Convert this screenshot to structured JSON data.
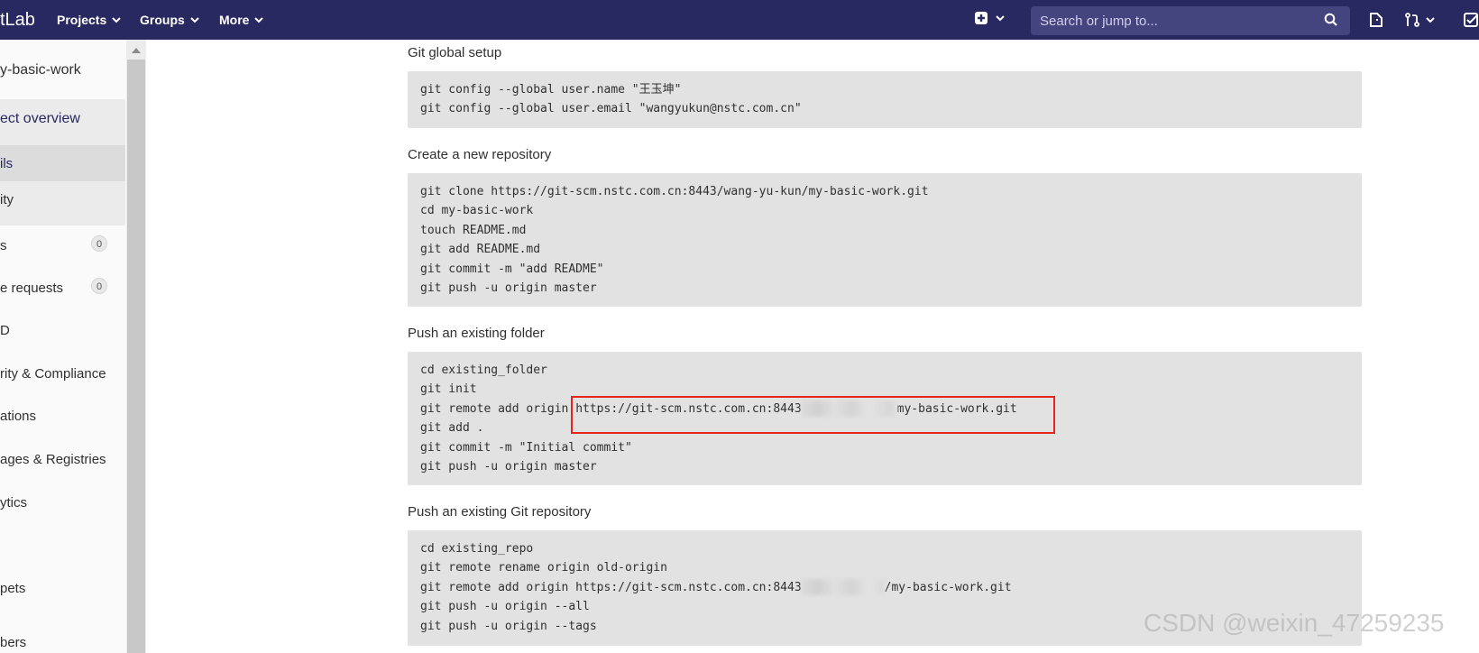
{
  "header": {
    "logo_text": "tLab",
    "nav": {
      "projects": "Projects",
      "groups": "Groups",
      "more": "More"
    },
    "search_placeholder": "Search or jump to..."
  },
  "sidebar": {
    "project_name": "y-basic-work",
    "items": {
      "overview": "ect overview",
      "details": "ils",
      "activity": "ity",
      "issues": "s",
      "issues_count": "0",
      "merge_requests": "e requests",
      "merge_requests_count": "0",
      "cicd": "D",
      "security": "rity & Compliance",
      "operations": "ations",
      "packages": "ages & Registries",
      "analytics": "ytics",
      "snippets": "pets",
      "members": "bers"
    }
  },
  "main": {
    "global_setup": {
      "title": "Git global setup",
      "lines": [
        "git config --global user.name \"王玉坤\"",
        "git config --global user.email \"wangyukun@nstc.com.cn\""
      ]
    },
    "new_repo": {
      "title": "Create a new repository",
      "lines": [
        "git clone https://git-scm.nstc.com.cn:8443/wang-yu-kun/my-basic-work.git",
        "cd my-basic-work",
        "touch README.md",
        "git add README.md",
        "git commit -m \"add README\"",
        "git push -u origin master"
      ]
    },
    "existing_folder": {
      "title": "Push an existing folder",
      "line1": "cd existing_folder",
      "line2": "git init",
      "line3_prefix": "git remote add origin ",
      "line3_url_start": "https://git-scm.nstc.com.cn:8443",
      "line3_url_end": "my-basic-work.git",
      "line4": "git add .",
      "line5": "git commit -m \"Initial commit\"",
      "line6": "git push -u origin master"
    },
    "existing_repo": {
      "title": "Push an existing Git repository",
      "line1": "cd existing_repo",
      "line2": "git remote rename origin old-origin",
      "line3_prefix": "git remote add origin https://git-scm.nstc.com.cn:8443",
      "line3_end": "/my-basic-work.git",
      "line4": "git push -u origin --all",
      "line5": "git push -u origin --tags"
    }
  },
  "watermark": "CSDN @weixin_47259235",
  "colors": {
    "topbar": "#292961",
    "highlight": "#e62323"
  }
}
